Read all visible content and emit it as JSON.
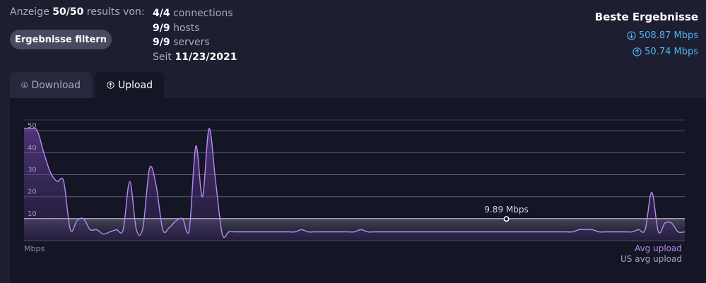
{
  "summary": {
    "prefix": "Anzeige",
    "count": "50/50",
    "suffix": "results von:"
  },
  "filter_button": {
    "label": "Ergebnisse filtern"
  },
  "stats": {
    "connections_value": "4/4",
    "connections_label": "connections",
    "hosts_value": "9/9",
    "hosts_label": "hosts",
    "servers_value": "9/9",
    "servers_label": "servers",
    "since_label": "Seit",
    "since_date": "11/23/2021"
  },
  "best_results": {
    "title": "Beste Ergebnisse",
    "download": "508.87 Mbps",
    "upload": "50.74 Mbps",
    "color": "#4eb4f0"
  },
  "tabs": [
    {
      "label": "Download",
      "icon": "arrow-down-circle-icon",
      "active": false
    },
    {
      "label": "Upload",
      "icon": "arrow-up-circle-icon",
      "active": true
    }
  ],
  "chart_data": {
    "type": "area",
    "x": [
      0,
      1,
      2,
      3,
      4,
      5,
      6,
      7,
      8,
      9,
      10,
      11,
      12,
      13,
      14,
      15,
      16,
      17,
      18,
      19,
      20,
      21,
      22,
      23,
      24,
      25,
      26,
      27,
      28,
      29,
      30,
      31,
      32,
      33,
      34,
      35,
      36,
      37,
      38,
      39,
      40,
      41,
      42,
      43,
      44,
      45,
      46,
      47,
      48,
      49,
      50,
      51,
      52,
      53,
      54,
      55,
      56,
      57,
      58,
      59,
      60,
      61,
      62,
      63,
      64,
      65,
      66,
      67,
      68,
      69,
      70,
      71,
      72,
      73,
      74,
      75,
      76,
      77,
      78,
      79,
      80,
      81,
      82,
      83,
      84,
      85,
      86,
      87,
      88,
      89,
      90,
      91,
      92,
      93,
      94,
      95,
      96,
      97,
      98,
      99,
      100
    ],
    "series": [
      {
        "name": "Avg upload",
        "color": "#b98af0",
        "values": [
          51,
          51,
          50,
          40,
          31,
          27,
          27,
          5,
          9,
          10,
          5,
          5,
          3,
          4,
          5,
          5,
          27,
          5,
          6,
          33,
          25,
          5,
          6,
          9,
          10,
          5,
          43,
          20,
          51,
          27,
          3,
          4,
          4,
          4,
          4,
          4,
          4,
          4,
          4,
          4,
          4,
          4,
          5,
          4,
          4,
          4,
          4,
          4,
          4,
          4,
          4,
          5,
          4,
          4,
          4,
          4,
          4,
          4,
          4,
          4,
          4,
          4,
          4,
          4,
          4,
          4,
          4,
          4,
          4,
          4,
          4,
          4,
          4,
          4,
          4,
          4,
          4,
          4,
          4,
          4,
          4,
          4,
          4,
          4,
          5,
          5,
          5,
          4,
          4,
          4,
          4,
          4,
          4,
          5,
          5,
          22,
          4,
          8,
          8,
          4,
          4
        ]
      },
      {
        "name": "US avg upload",
        "color": "#ffffff",
        "values": [
          10,
          10,
          10,
          10,
          10,
          10,
          10,
          10,
          10,
          10,
          10,
          10,
          10,
          10,
          10,
          10,
          10,
          10,
          10,
          10,
          10,
          10,
          10,
          10,
          10,
          10,
          10,
          10,
          10,
          10,
          10,
          10,
          10,
          10,
          10,
          10,
          10,
          10,
          10,
          10,
          10,
          10,
          10,
          10,
          10,
          10,
          10,
          10,
          10,
          10,
          10,
          10,
          10,
          10,
          10,
          10,
          10,
          10,
          10,
          10,
          10,
          10,
          10,
          10,
          10,
          10,
          10,
          10,
          10,
          10,
          10,
          10,
          10,
          10,
          10,
          10,
          10,
          10,
          10,
          10,
          10,
          10,
          10,
          10,
          10,
          10,
          10,
          10,
          10,
          10,
          10,
          10,
          10,
          10,
          10,
          10,
          10,
          10,
          10,
          10,
          10
        ]
      }
    ],
    "yticks": [
      10,
      20,
      30,
      40,
      50
    ],
    "ylim": [
      0,
      52
    ],
    "ylabel": "Mbps",
    "grid": true,
    "legend": "bottom-right",
    "tooltip": {
      "x": 73,
      "value": 9.89,
      "label": "9.89 Mbps"
    }
  }
}
